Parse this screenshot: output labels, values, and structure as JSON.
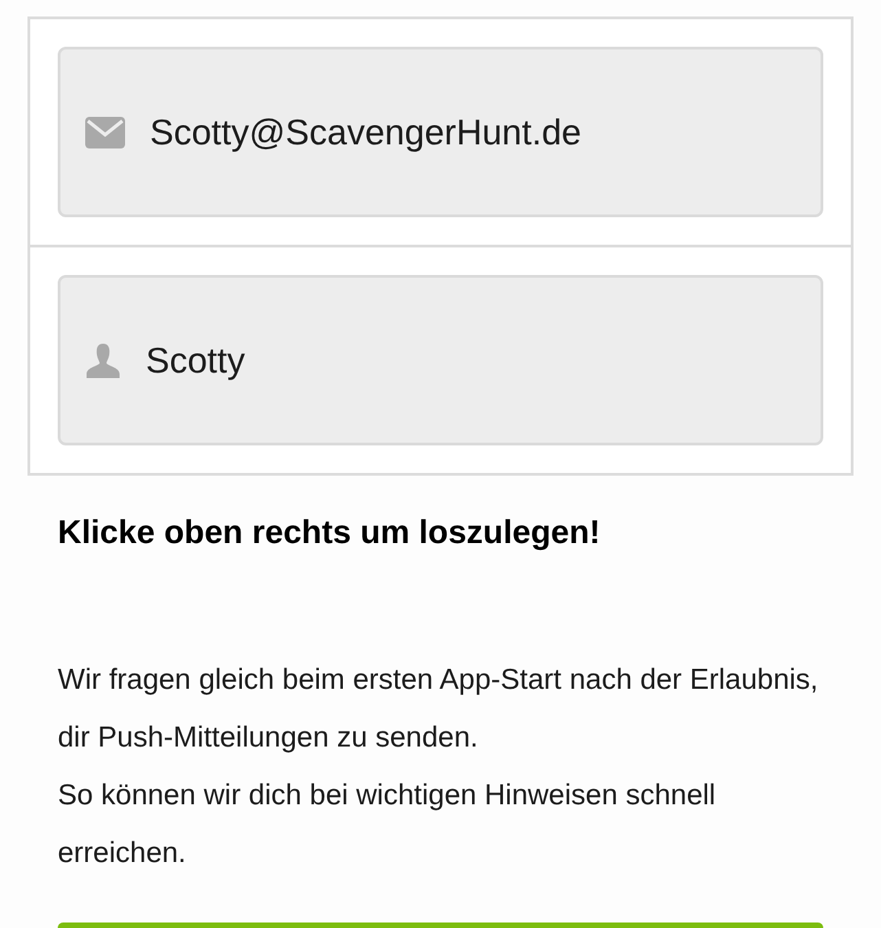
{
  "fields": [
    {
      "kind": "email",
      "value": "Scotty@ScavengerHunt.de"
    },
    {
      "kind": "user",
      "value": "Scotty"
    }
  ],
  "heading": "Klicke oben rechts um loszulegen!",
  "paragraphs": [
    "Wir fragen gleich beim ersten App-Start nach der Erlaubnis, dir Push-Mitteilungen zu senden.",
    "So können wir dich bei wichtigen Hinweisen schnell erreichen."
  ]
}
